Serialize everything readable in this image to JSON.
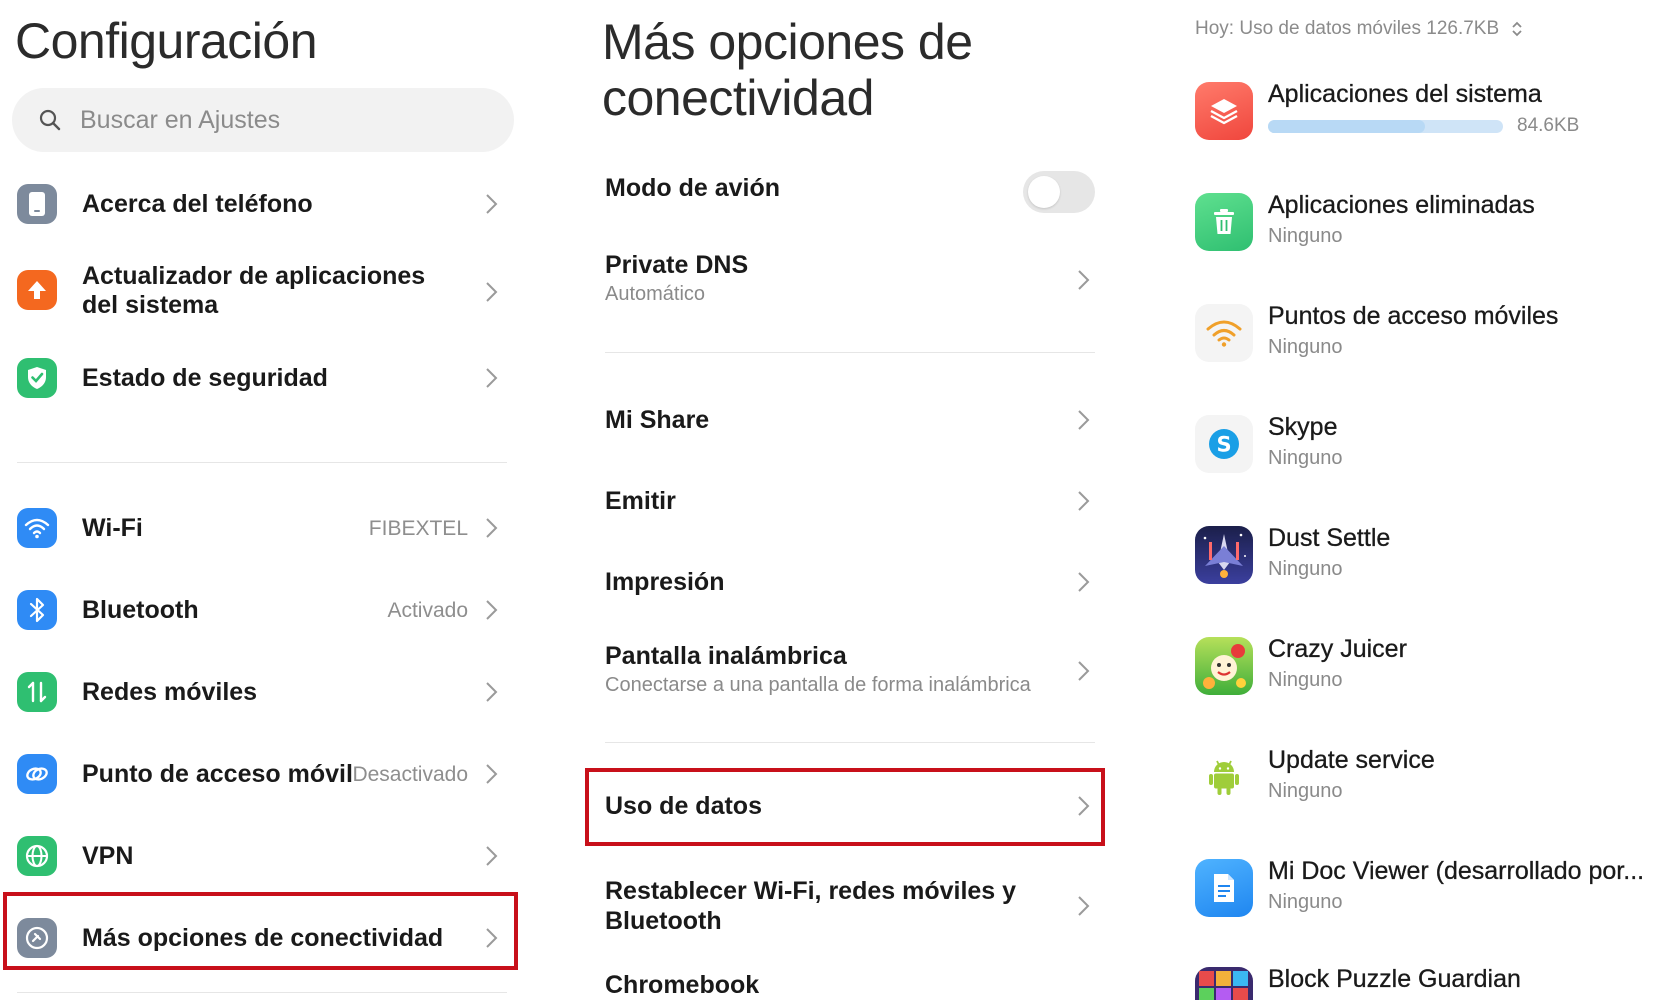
{
  "col1": {
    "title": "Configuración",
    "search_placeholder": "Buscar en Ajustes",
    "items": [
      {
        "label": "Acerca del teléfono",
        "value": ""
      },
      {
        "label": "Actualizador de aplicaciones del sistema",
        "value": ""
      },
      {
        "label": "Estado de seguridad",
        "value": ""
      },
      {
        "label": "Wi-Fi",
        "value": "FIBEXTEL"
      },
      {
        "label": "Bluetooth",
        "value": "Activado"
      },
      {
        "label": "Redes móviles",
        "value": ""
      },
      {
        "label": "Punto de acceso móvil",
        "value": "Desactivado"
      },
      {
        "label": "VPN",
        "value": ""
      },
      {
        "label": "Más opciones de conectividad",
        "value": ""
      }
    ]
  },
  "col2": {
    "title": "Más opciones de conectividad",
    "items": [
      {
        "label": "Modo de avión",
        "sub": ""
      },
      {
        "label": "Private DNS",
        "sub": "Automático"
      },
      {
        "label": "Mi Share",
        "sub": ""
      },
      {
        "label": "Emitir",
        "sub": ""
      },
      {
        "label": "Impresión",
        "sub": ""
      },
      {
        "label": "Pantalla inalámbrica",
        "sub": "Conectarse a una pantalla de forma inalámbrica"
      },
      {
        "label": "Uso de datos",
        "sub": ""
      },
      {
        "label": "Restablecer Wi-Fi, redes móviles y Bluetooth",
        "sub": ""
      },
      {
        "label": "Chromebook",
        "sub": ""
      }
    ],
    "airplane_mode_on": false
  },
  "col3": {
    "header": "Hoy: Uso de datos móviles 126.7KB",
    "apps": [
      {
        "name": "Aplicaciones del sistema",
        "usage": "84.6KB",
        "bar_fraction": 0.67
      },
      {
        "name": "Aplicaciones eliminadas",
        "usage": "Ninguno"
      },
      {
        "name": "Puntos de acceso móviles",
        "usage": "Ninguno"
      },
      {
        "name": "Skype",
        "usage": "Ninguno"
      },
      {
        "name": "Dust Settle",
        "usage": "Ninguno"
      },
      {
        "name": "Crazy Juicer",
        "usage": "Ninguno"
      },
      {
        "name": "Update service",
        "usage": "Ninguno"
      },
      {
        "name": "Mi Doc Viewer (desarrollado por...",
        "usage": "Ninguno"
      },
      {
        "name": "Block Puzzle Guardian",
        "usage": ""
      }
    ]
  },
  "colors": {
    "highlight": "#c8101a",
    "wifi_blue": "#2f8bf5",
    "green": "#2fbf71",
    "orange": "#f4681f"
  }
}
